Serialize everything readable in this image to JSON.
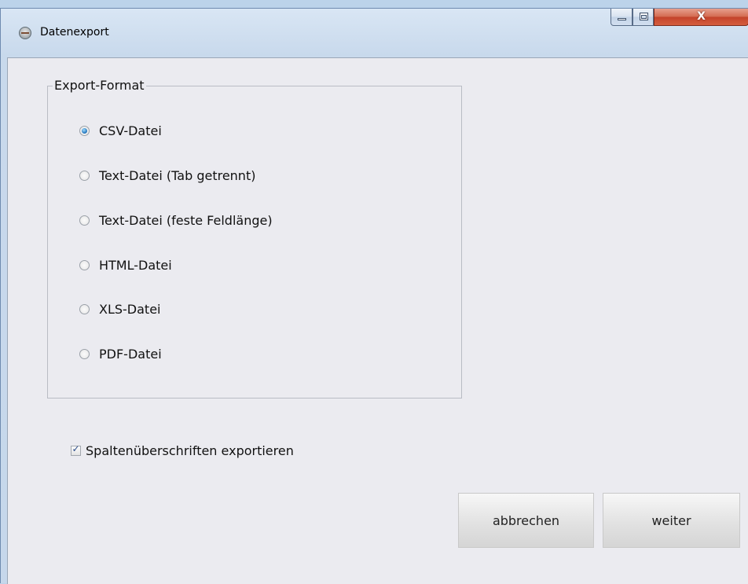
{
  "window": {
    "title": "Datenexport"
  },
  "caption_buttons": {
    "close_glyph": "X"
  },
  "export_format": {
    "legend": "Export-Format",
    "options": [
      {
        "label": "CSV-Datei",
        "checked": true
      },
      {
        "label": "Text-Datei (Tab getrennt)",
        "checked": false
      },
      {
        "label": "Text-Datei (feste Feldlänge)",
        "checked": false
      },
      {
        "label": "HTML-Datei",
        "checked": false
      },
      {
        "label": "XLS-Datei",
        "checked": false
      },
      {
        "label": "PDF-Datei",
        "checked": false
      }
    ]
  },
  "column_headers_option": {
    "label": "Spaltenüberschriften exportieren",
    "checked": true,
    "check_glyph": "✓"
  },
  "buttons": {
    "cancel_label": "abbrechen",
    "next_label": "weiter"
  },
  "colors": {
    "client_bg": "#ebebf0",
    "frame_bg": "#c8d9ec",
    "close_button": "#c3422a",
    "radio_selected": "#1e6fb8"
  }
}
